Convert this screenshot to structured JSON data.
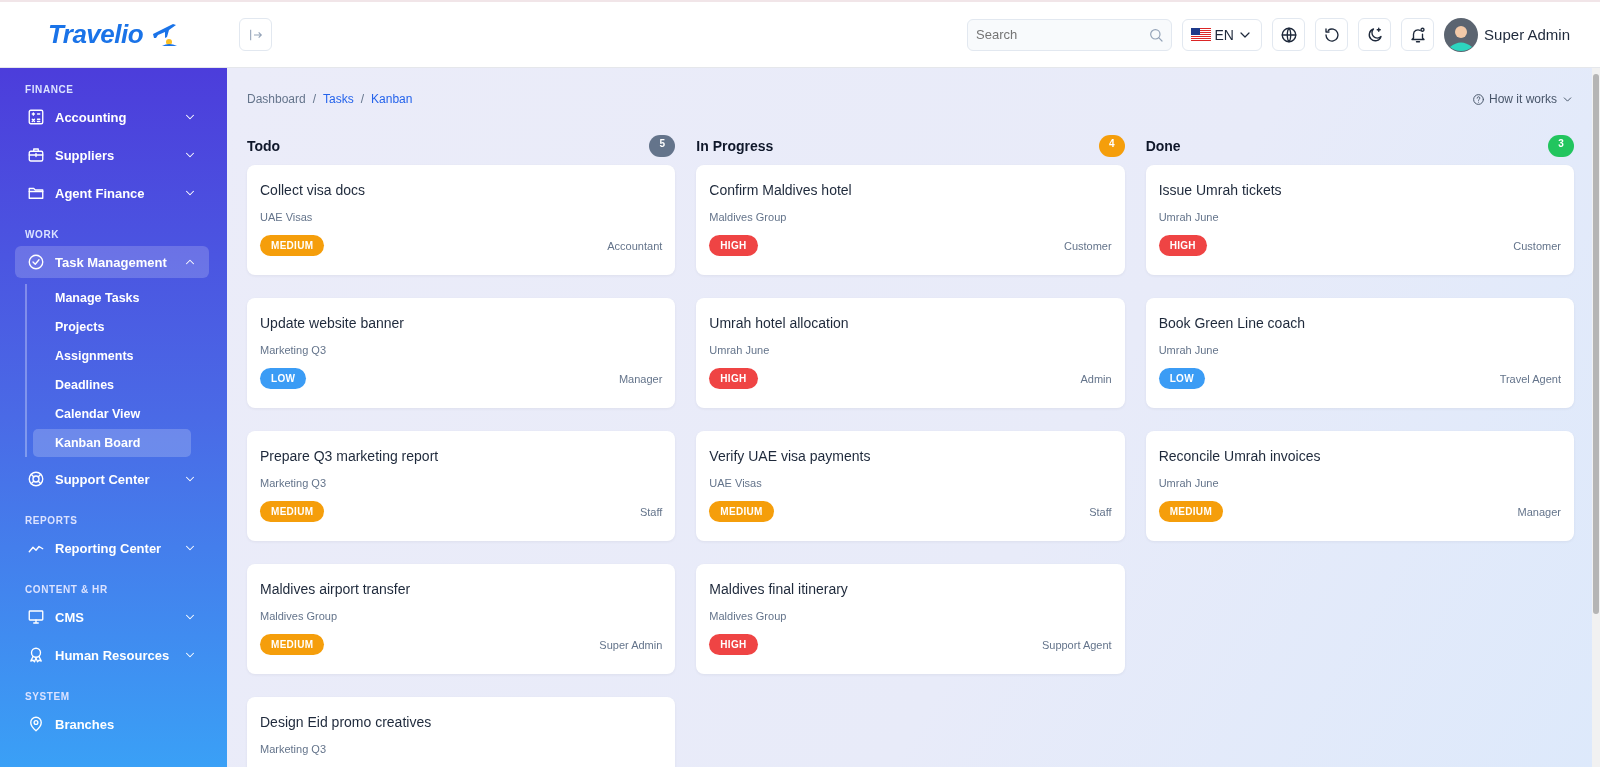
{
  "header": {
    "logo": "Travelio",
    "search": {
      "placeholder": "Search"
    },
    "language": "EN",
    "user": "Super Admin"
  },
  "sidebar": {
    "sections": [
      {
        "title": "FINANCE",
        "items": [
          {
            "label": "Accounting",
            "expanded": false
          },
          {
            "label": "Suppliers",
            "expanded": false
          },
          {
            "label": "Agent Finance",
            "expanded": false
          }
        ]
      },
      {
        "title": "WORK",
        "items": [
          {
            "label": "Task Management",
            "expanded": true,
            "children": [
              {
                "label": "Manage Tasks",
                "selected": false
              },
              {
                "label": "Projects",
                "selected": false
              },
              {
                "label": "Assignments",
                "selected": false
              },
              {
                "label": "Deadlines",
                "selected": false
              },
              {
                "label": "Calendar View",
                "selected": false
              },
              {
                "label": "Kanban Board",
                "selected": true
              }
            ]
          },
          {
            "label": "Support Center",
            "expanded": false
          }
        ]
      },
      {
        "title": "REPORTS",
        "items": [
          {
            "label": "Reporting Center",
            "expanded": false
          }
        ]
      },
      {
        "title": "CONTENT & HR",
        "items": [
          {
            "label": "CMS",
            "expanded": false
          },
          {
            "label": "Human Resources",
            "expanded": false
          }
        ]
      },
      {
        "title": "SYSTEM",
        "items": [
          {
            "label": "Branches"
          }
        ]
      }
    ]
  },
  "breadcrumb": [
    {
      "kind": "plain",
      "text": "Dashboard"
    },
    {
      "kind": "separator",
      "text": "/"
    },
    {
      "kind": "link",
      "text": "Tasks"
    },
    {
      "kind": "separator",
      "text": "/"
    },
    {
      "kind": "link",
      "text": "Kanban"
    }
  ],
  "help": "How it works",
  "columns": [
    {
      "title": "Todo",
      "count": "5",
      "color": "#64748b",
      "cards": [
        {
          "title": "Collect visa docs",
          "project": "UAE Visas",
          "priority": {
            "text": "MEDIUM",
            "color": "#f59e0b"
          },
          "assignee": "Accountant"
        },
        {
          "title": "Update website banner",
          "project": "Marketing Q3",
          "priority": {
            "text": "LOW",
            "color": "#3b9cf5"
          },
          "assignee": "Manager"
        },
        {
          "title": "Prepare Q3 marketing report",
          "project": "Marketing Q3",
          "priority": {
            "text": "MEDIUM",
            "color": "#f59e0b"
          },
          "assignee": "Staff"
        },
        {
          "title": "Maldives airport transfer",
          "project": "Maldives Group",
          "priority": {
            "text": "MEDIUM",
            "color": "#f59e0b"
          },
          "assignee": "Super Admin"
        },
        {
          "title": "Design Eid promo creatives",
          "project": "Marketing Q3"
        }
      ]
    },
    {
      "title": "In Progress",
      "count": "4",
      "color": "#f59e0b",
      "cards": [
        {
          "title": "Confirm Maldives hotel",
          "project": "Maldives Group",
          "priority": {
            "text": "HIGH",
            "color": "#ef4444"
          },
          "assignee": "Customer"
        },
        {
          "title": "Umrah hotel allocation",
          "project": "Umrah June",
          "priority": {
            "text": "HIGH",
            "color": "#ef4444"
          },
          "assignee": "Admin"
        },
        {
          "title": "Verify UAE visa payments",
          "project": "UAE Visas",
          "priority": {
            "text": "MEDIUM",
            "color": "#f59e0b"
          },
          "assignee": "Staff"
        },
        {
          "title": "Maldives final itinerary",
          "project": "Maldives Group",
          "priority": {
            "text": "HIGH",
            "color": "#ef4444"
          },
          "assignee": "Support Agent"
        }
      ]
    },
    {
      "title": "Done",
      "count": "3",
      "color": "#22c55e",
      "cards": [
        {
          "title": "Issue Umrah tickets",
          "project": "Umrah June",
          "priority": {
            "text": "HIGH",
            "color": "#ef4444"
          },
          "assignee": "Customer"
        },
        {
          "title": "Book Green Line coach",
          "project": "Umrah June",
          "priority": {
            "text": "LOW",
            "color": "#3b9cf5"
          },
          "assignee": "Travel Agent"
        },
        {
          "title": "Reconcile Umrah invoices",
          "project": "Umrah June",
          "priority": {
            "text": "MEDIUM",
            "color": "#f59e0b"
          },
          "assignee": "Manager"
        }
      ]
    }
  ]
}
